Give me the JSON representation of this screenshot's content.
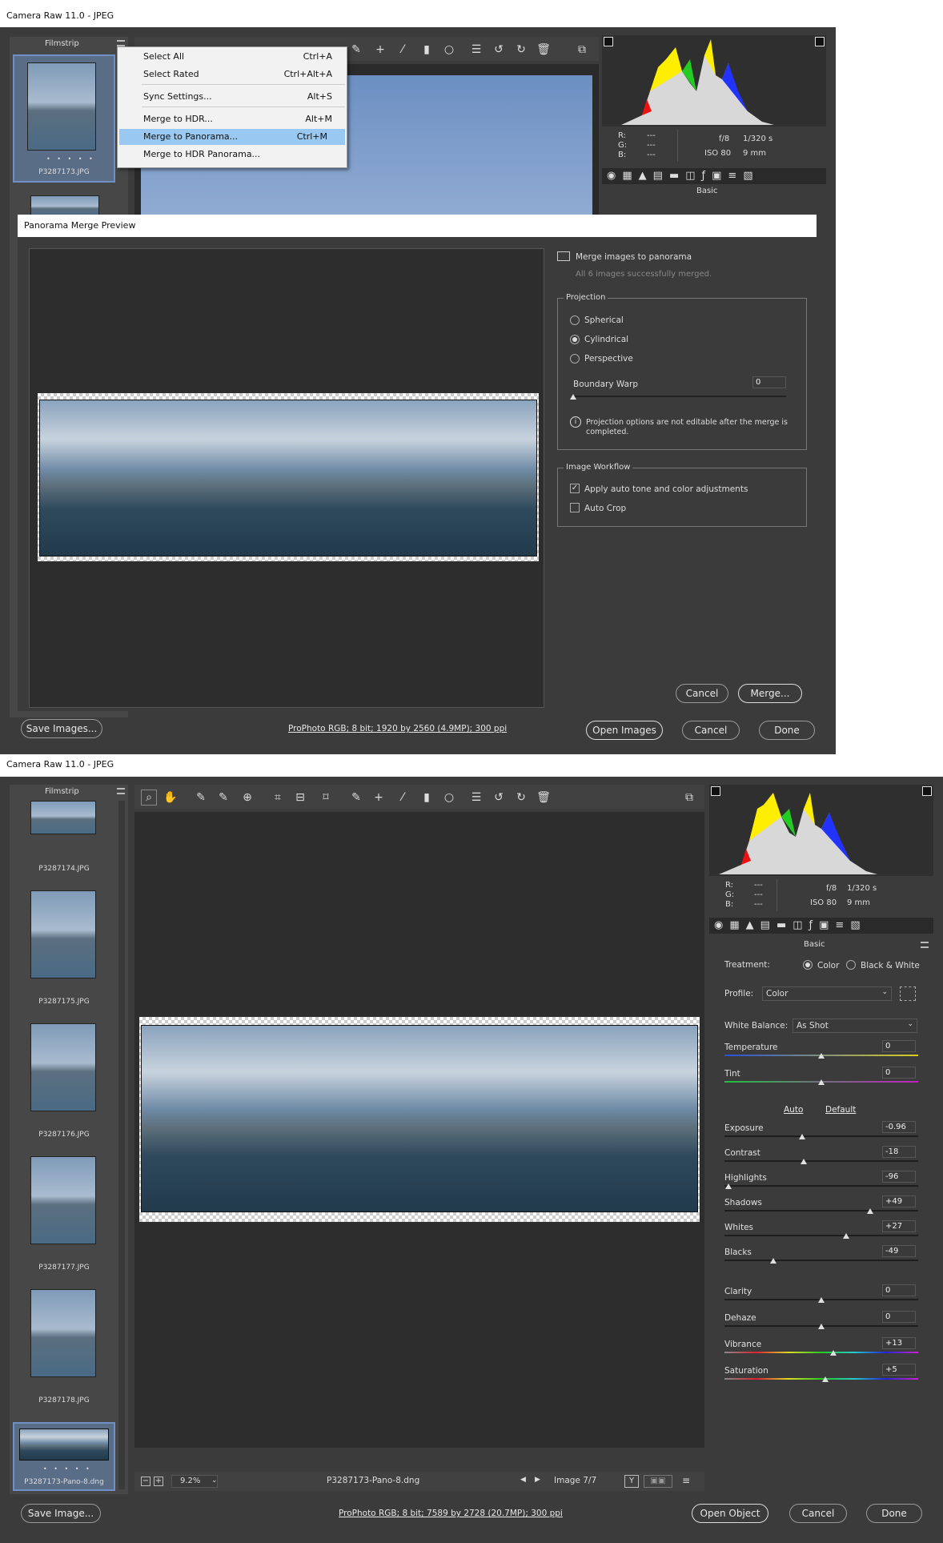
{
  "top": {
    "title": "Camera Raw 11.0  -  JPEG",
    "filmstrip_label": "Filmstrip",
    "thumb_name": "P3287173.JPG",
    "menu": [
      {
        "label": "Select All",
        "shortcut": "Ctrl+A"
      },
      {
        "label": "Select Rated",
        "shortcut": "Ctrl+Alt+A"
      },
      {
        "label": "Sync Settings...",
        "shortcut": "Alt+S"
      },
      {
        "label": "Merge to HDR...",
        "shortcut": "Alt+M"
      },
      {
        "label": "Merge to Panorama...",
        "shortcut": "Ctrl+M"
      },
      {
        "label": "Merge to HDR Panorama...",
        "shortcut": ""
      }
    ],
    "info": {
      "r": "R:",
      "g": "G:",
      "b": "B:",
      "dash": "---",
      "aperture": "f/8",
      "shutter": "1/320 s",
      "iso": "ISO 80",
      "focal": "9 mm"
    },
    "panel_label": "Basic",
    "dialog": {
      "title": "Panorama Merge Preview",
      "heading": "Merge images to panorama",
      "status": "All 6 images successfully merged.",
      "projection_label": "Projection",
      "options": [
        "Spherical",
        "Cylindrical",
        "Perspective"
      ],
      "boundary_label": "Boundary Warp",
      "boundary_value": "0",
      "note": "Projection options are not editable after the merge is completed.",
      "workflow_label": "Image Workflow",
      "check1": "Apply auto tone and color adjustments",
      "check2": "Auto Crop",
      "cancel": "Cancel",
      "merge": "Merge..."
    },
    "save": "Save Images...",
    "workflow_link": "ProPhoto RGB; 8 bit; 1920 by 2560 (4.9MP); 300 ppi",
    "open": "Open Images",
    "cancel": "Cancel",
    "done": "Done"
  },
  "bottom": {
    "title": "Camera Raw 11.0  -  JPEG",
    "filmstrip_label": "Filmstrip",
    "thumbs": [
      "P3287174.JPG",
      "P3287175.JPG",
      "P3287176.JPG",
      "P3287177.JPG",
      "P3287178.JPG",
      "P3287173-Pano-8.dng"
    ],
    "info": {
      "r": "R:",
      "g": "G:",
      "b": "B:",
      "dash": "---",
      "aperture": "f/8",
      "shutter": "1/320 s",
      "iso": "ISO 80",
      "focal": "9 mm"
    },
    "panel_label": "Basic",
    "treatment_label": "Treatment:",
    "treatment_color": "Color",
    "treatment_bw": "Black & White",
    "profile_label": "Profile:",
    "profile_value": "Color",
    "wb_label": "White Balance:",
    "wb_value": "As Shot",
    "auto": "Auto",
    "default": "Default",
    "sliders": [
      {
        "label": "Temperature",
        "value": "0",
        "pos": 0.5
      },
      {
        "label": "Tint",
        "value": "0",
        "pos": 0.5
      },
      {
        "label": "Exposure",
        "value": "-0.96",
        "pos": 0.4
      },
      {
        "label": "Contrast",
        "value": "-18",
        "pos": 0.41
      },
      {
        "label": "Highlights",
        "value": "-96",
        "pos": 0.02
      },
      {
        "label": "Shadows",
        "value": "+49",
        "pos": 0.75
      },
      {
        "label": "Whites",
        "value": "+27",
        "pos": 0.63
      },
      {
        "label": "Blacks",
        "value": "-49",
        "pos": 0.25
      },
      {
        "label": "Clarity",
        "value": "0",
        "pos": 0.5
      },
      {
        "label": "Dehaze",
        "value": "0",
        "pos": 0.5
      },
      {
        "label": "Vibrance",
        "value": "+13",
        "pos": 0.56
      },
      {
        "label": "Saturation",
        "value": "+5",
        "pos": 0.52
      }
    ],
    "zoom": "9.2%",
    "filename": "P3287173-Pano-8.dng",
    "image_counter": "Image 7/7",
    "save": "Save Image...",
    "workflow_link": "ProPhoto RGB; 8 bit; 7589 by 2728 (20.7MP); 300 ppi",
    "open": "Open Object",
    "cancel": "Cancel",
    "done": "Done"
  }
}
